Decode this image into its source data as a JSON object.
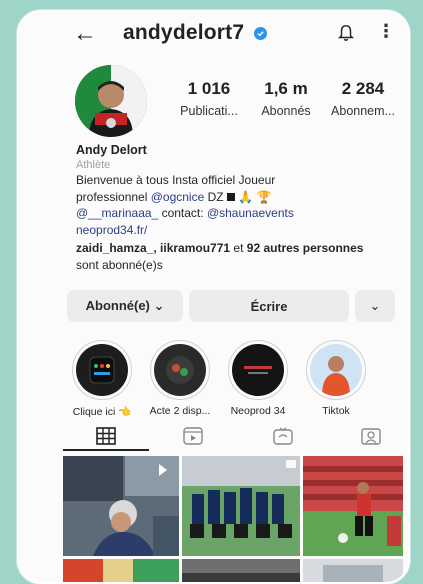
{
  "header": {
    "username": "andydelort7",
    "back_icon": "arrow-left-icon",
    "verified_icon": "verified-badge-icon",
    "notification_icon": "bell-icon",
    "menu_icon": "more-vertical-icon"
  },
  "stats": [
    {
      "value": "1 016",
      "label": "Publicati..."
    },
    {
      "value": "1,6 m",
      "label": "Abonnés"
    },
    {
      "value": "2 284",
      "label": "Abonnem..."
    }
  ],
  "profile": {
    "name": "Andy Delort",
    "category": "Athlète",
    "bio_line1": "Bienvenue à tous Insta officiel Joueur",
    "bio_line2_pre": "professionnel ",
    "bio_mention1": "@ogcnice",
    "bio_line2_post": " DZ",
    "bio_mention2": "@__marinaaa_",
    "bio_line3_post": " contact: ",
    "bio_mention3": "@shaunaevents",
    "bio_link": "neoprod34.fr/",
    "followed_by_names": "zaidi_hamza_, iikramou771",
    "followed_by_mid": " et ",
    "followed_by_count": "92 autres personnes",
    "followed_by_tail": " sont abonné(e)s"
  },
  "actions": {
    "follow_label": "Abonné(e) ⌄",
    "message_label": "Écrire",
    "suggest_label": "⌄"
  },
  "highlights": [
    {
      "caption": "Clique ici 👈"
    },
    {
      "caption": "Acte 2 disp..."
    },
    {
      "caption": "Neoprod 34"
    },
    {
      "caption": "Tiktok"
    }
  ],
  "tabs": [
    "grid-icon",
    "reels-icon",
    "igtv-icon",
    "tagged-icon"
  ],
  "colors": {
    "background": "#9fd5c8",
    "verified": "#2a93f0",
    "link": "#2b3f86",
    "button": "#ececec"
  }
}
